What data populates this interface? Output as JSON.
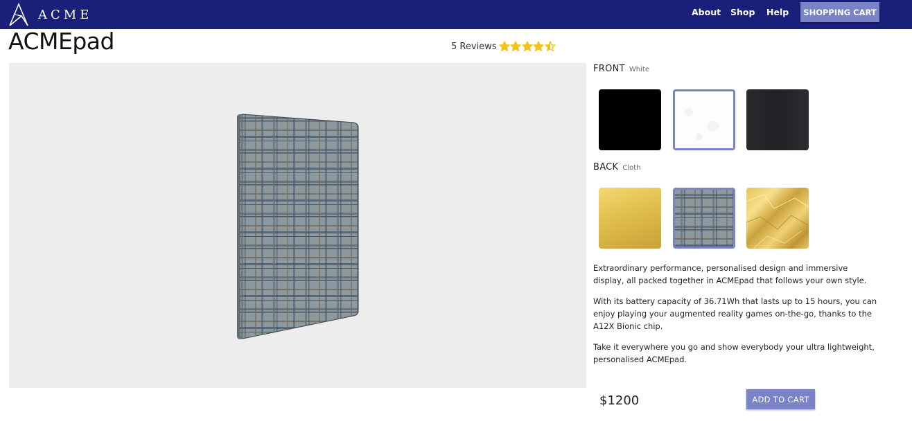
{
  "header": {
    "brand": "ACME",
    "logo_icon": "mountain-triangle-logo",
    "nav": [
      "About",
      "Shop",
      "Help"
    ],
    "cart_label": "SHOPPING CART",
    "bg_color": "#1a1f7a"
  },
  "product": {
    "title": "ACMEpad",
    "reviews_label": "5 Reviews",
    "rating": 4.5,
    "rating_max": 5,
    "star_color": "#f2c314",
    "price": "$1200",
    "add_to_cart": "ADD TO CART"
  },
  "options": {
    "front": {
      "label": "FRONT",
      "selected": "White",
      "swatches": [
        "black",
        "white",
        "charcoal"
      ],
      "selected_index": 1
    },
    "back": {
      "label": "BACK",
      "selected": "Cloth",
      "swatches": [
        "gold",
        "cloth-plaid",
        "gold-foil"
      ],
      "selected_index": 1
    }
  },
  "description": [
    "Extraordinary performance, personalised design and immersive display, all packed together in ACMEpad that follows your own style.",
    "With its battery capacity of 36.71Wh that lasts up to 15 hours, you can enjoy playing your augmented reality games on-the-go, thanks to the A12X Bionic chip.",
    "Take it everywhere you go and show everybody your ultra lightweight, personalised ACMEpad."
  ],
  "colors": {
    "accent": "#7b83c8"
  }
}
